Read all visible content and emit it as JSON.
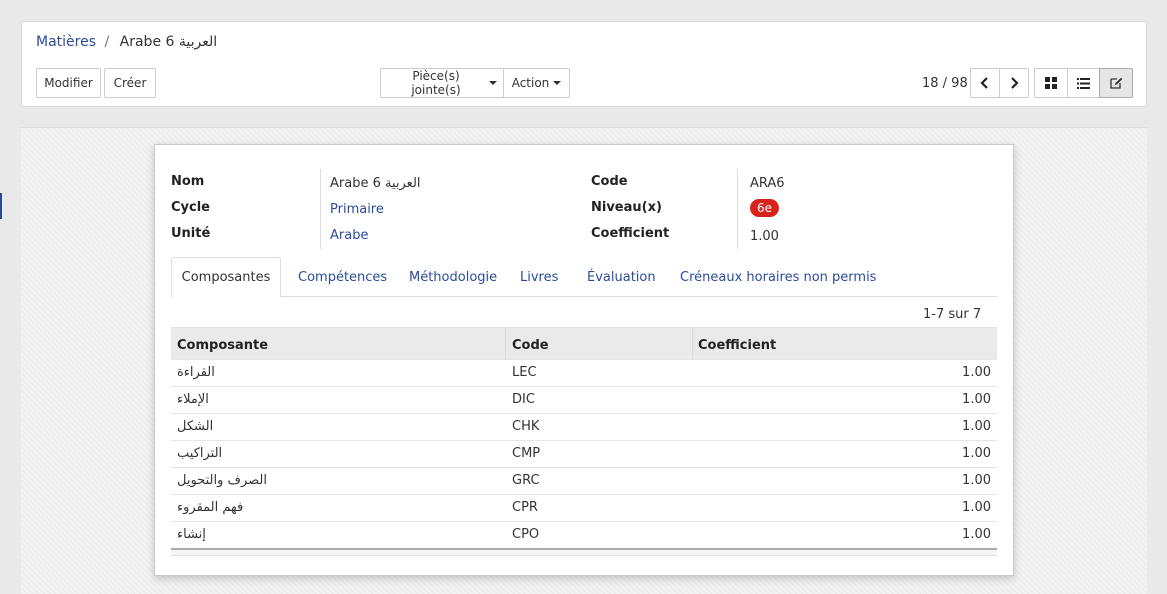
{
  "breadcrumb": {
    "parent": "Matières",
    "separator": "/",
    "current": "Arabe 6 العربية"
  },
  "toolbar": {
    "modifier": "Modifier",
    "creer": "Créer",
    "attachments": "Pièce(s) jointe(s)",
    "action": "Action"
  },
  "pager": {
    "text": "18 / 98"
  },
  "form": {
    "nom_label": "Nom",
    "nom_value": "Arabe 6 العربية",
    "cycle_label": "Cycle",
    "cycle_value": "Primaire",
    "unite_label": "Unité",
    "unite_value": "Arabe",
    "code_label": "Code",
    "code_value": "ARA6",
    "niveau_label": "Niveau(x)",
    "niveau_value": "6e",
    "coefficient_label": "Coefficient",
    "coefficient_value": "1.00"
  },
  "tabs": [
    {
      "label": "Composantes",
      "active": true
    },
    {
      "label": "Compétences",
      "active": false
    },
    {
      "label": "Méthodologie",
      "active": false
    },
    {
      "label": "Livres",
      "active": false
    },
    {
      "label": "Évaluation",
      "active": false
    },
    {
      "label": "Créneaux horaires non permis",
      "active": false
    }
  ],
  "list_pager": "1-7 sur 7",
  "table": {
    "headers": [
      "Composante",
      "Code",
      "Coefficient"
    ],
    "rows": [
      {
        "composante": "القراءة",
        "code": "LEC",
        "coefficient": "1.00"
      },
      {
        "composante": "الإملاء",
        "code": "DIC",
        "coefficient": "1.00"
      },
      {
        "composante": "الشكل",
        "code": "CHK",
        "coefficient": "1.00"
      },
      {
        "composante": "التراكيب",
        "code": "CMP",
        "coefficient": "1.00"
      },
      {
        "composante": "الصرف والتحويل",
        "code": "GRC",
        "coefficient": "1.00"
      },
      {
        "composante": "فهم المقروء",
        "code": "CPR",
        "coefficient": "1.00"
      },
      {
        "composante": "إنشاء",
        "code": "CPO",
        "coefficient": "1.00"
      }
    ]
  },
  "colors": {
    "link": "#2b4c9b",
    "badge": "#d9221c"
  },
  "icons": [
    "chevron-left-icon",
    "chevron-right-icon",
    "kanban-view-icon",
    "list-view-icon",
    "form-view-icon"
  ]
}
